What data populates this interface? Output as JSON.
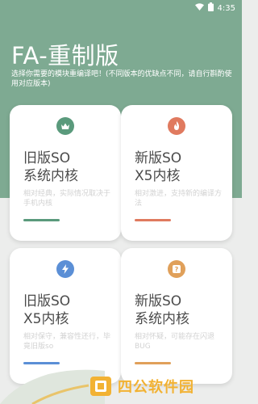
{
  "status_bar": {
    "time": "4:35"
  },
  "header": {
    "title": "FA-重制版",
    "subtitle": "选择你需要的模块重编译吧！(不同版本的优缺点不同，请自行斟酌使用对应版本)"
  },
  "cards": [
    {
      "icon": "crown-icon",
      "icon_color": "#5a9a7c",
      "title_line1": "旧版SO",
      "title_line2": "系统内核",
      "desc": "相对经典，实际情况取决于手机内核",
      "bar_color": "#5a9a7c"
    },
    {
      "icon": "flame-icon",
      "icon_color": "#e07a5f",
      "title_line1": "新版SO",
      "title_line2": "X5内核",
      "desc": "相对激进，支持新的编译方法",
      "bar_color": "#e07a5f"
    },
    {
      "icon": "lightning-icon",
      "icon_color": "#5b8fd6",
      "title_line1": "旧版SO",
      "title_line2": "X5内核",
      "desc": "相对保守，兼容性还行，毕竟旧版so",
      "bar_color": "#5b8fd6"
    },
    {
      "icon": "question-icon",
      "icon_color": "#e0a05a",
      "title_line1": "新版SO",
      "title_line2": "系统内核",
      "desc": "相对怀疑，可能存在闪退BUG",
      "bar_color": "#e0a05a"
    }
  ],
  "watermark": {
    "text": "四公软件园"
  }
}
